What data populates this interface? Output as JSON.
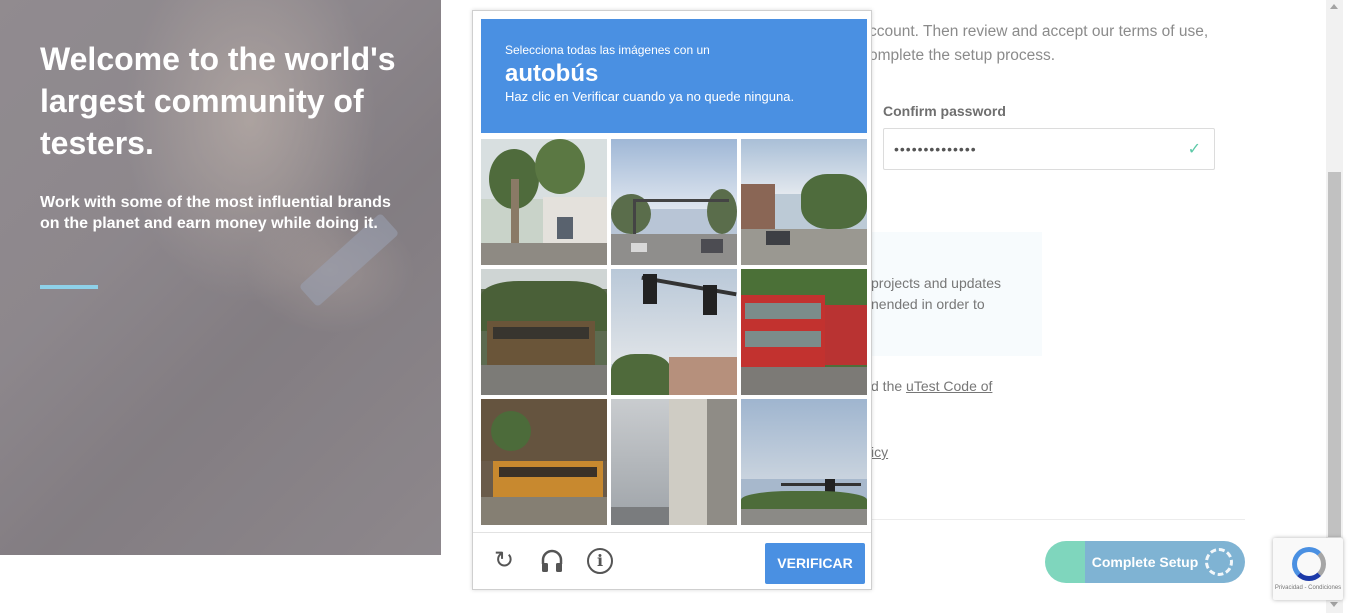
{
  "hero": {
    "title": "Welcome to the world's largest community of testers.",
    "subtitle": "Work with some of the most influential brands on the planet and earn money while doing it."
  },
  "form": {
    "intro_text": "ccount. Then review and accept our terms of use, omplete the setup process.",
    "confirm_password_label": "Confirm password",
    "confirm_password_value": "••••••••••••••",
    "info_text": "projects and updates nended in order to",
    "code_prefix": "d the ",
    "code_link": "uTest Code of",
    "policy_fragment": "icy",
    "complete_button": "Complete Setup"
  },
  "captcha": {
    "instruction_line1": "Selecciona todas las imágenes con un",
    "target_object": "autobús",
    "instruction_line3": "Haz clic en Verificar cuando ya no quede ninguna.",
    "verify_button": "VERIFICAR",
    "tiles": [
      "palm trees and building",
      "street with traffic lights",
      "suburban street with car",
      "bus",
      "traffic lights",
      "red double-decker bus",
      "bus",
      "concrete pillar",
      "street with trees"
    ]
  },
  "badge": {
    "caption": "Privacidad - Condiciones"
  },
  "colors": {
    "captcha_blue": "#4a90e2",
    "accent_line": "#8ed1e9",
    "complete_green": "#7fd6bd",
    "complete_blue": "#7fb3d3"
  }
}
